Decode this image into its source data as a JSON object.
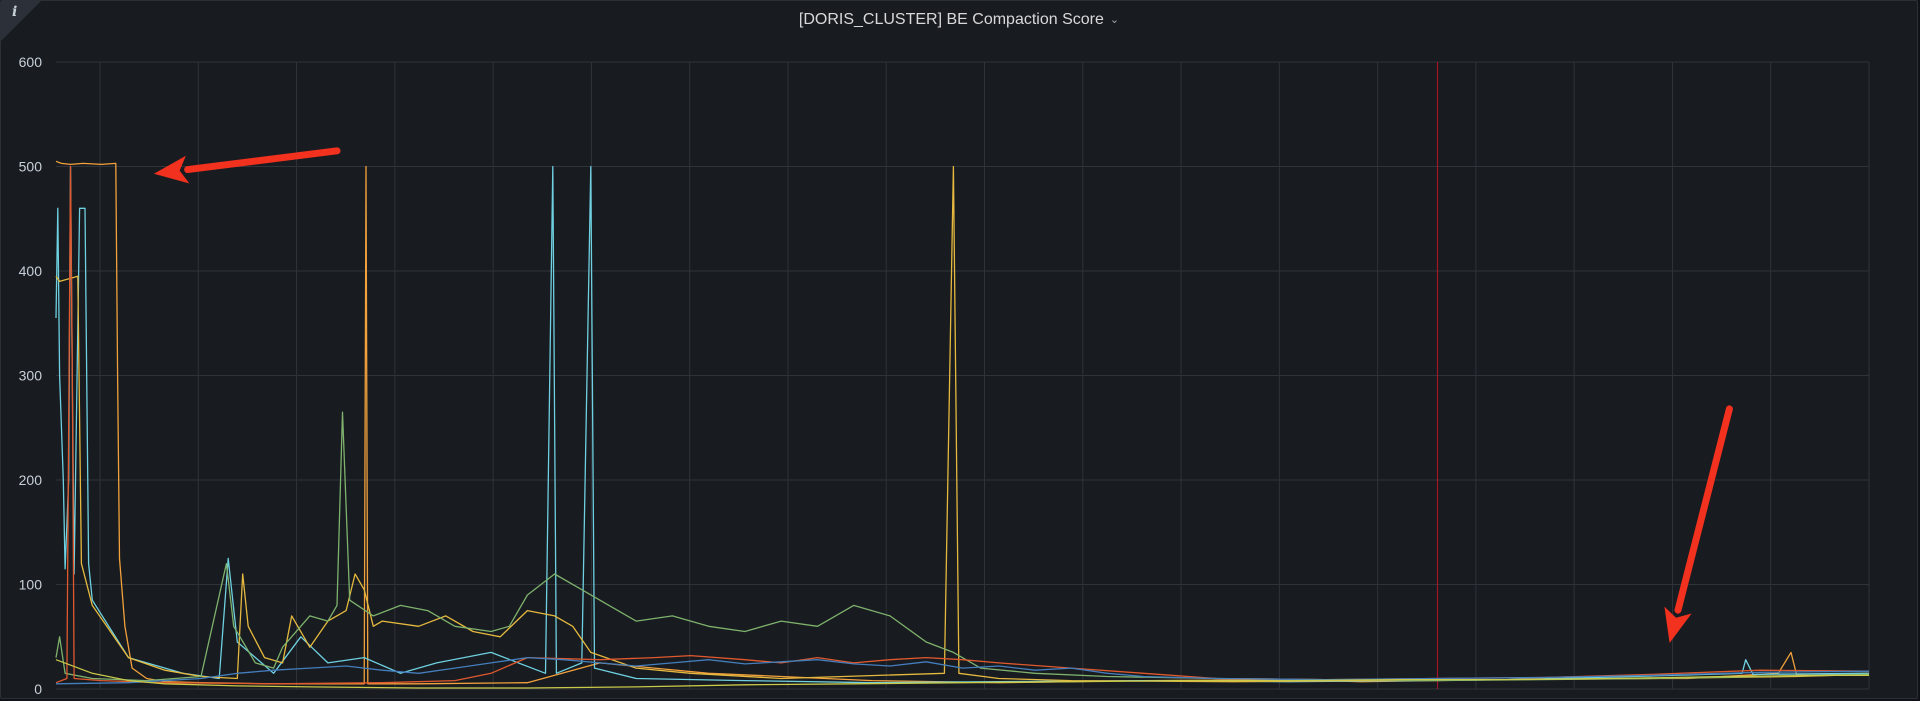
{
  "panel": {
    "title": "[DORIS_CLUSTER] BE Compaction Score",
    "info_icon": "info-icon",
    "menu_icon": "chevron-down-icon"
  },
  "chart_data": {
    "type": "line",
    "title": "[DORIS_CLUSTER] BE Compaction Score",
    "xlabel": "",
    "ylabel": "",
    "ylim": [
      0,
      600
    ],
    "yticks": [
      0,
      100,
      200,
      300,
      400,
      500,
      600
    ],
    "xlim": [
      0,
      1000
    ],
    "grid": true,
    "legend": "none",
    "annotation_x": 762,
    "annotation_color": "#c4162a",
    "arrow_color": "#f2311f",
    "series": [
      {
        "color": "#f2a13c",
        "points": [
          [
            0,
            505
          ],
          [
            3,
            503
          ],
          [
            8,
            502
          ],
          [
            15,
            503
          ],
          [
            25,
            502
          ],
          [
            33,
            503
          ],
          [
            34,
            300
          ],
          [
            35,
            125
          ],
          [
            38,
            60
          ],
          [
            42,
            20
          ],
          [
            50,
            10
          ],
          [
            60,
            7
          ],
          [
            80,
            6
          ],
          [
            120,
            5
          ],
          [
            170,
            5
          ],
          [
            171,
            500
          ],
          [
            172,
            5
          ],
          [
            200,
            5
          ],
          [
            260,
            6
          ],
          [
            300,
            25
          ],
          [
            330,
            20
          ],
          [
            360,
            15
          ],
          [
            400,
            12
          ],
          [
            450,
            8
          ],
          [
            520,
            6
          ],
          [
            600,
            8
          ],
          [
            680,
            9
          ],
          [
            720,
            7
          ],
          [
            760,
            8
          ],
          [
            800,
            9
          ],
          [
            850,
            10
          ],
          [
            900,
            10
          ],
          [
            950,
            15
          ],
          [
            957,
            35
          ],
          [
            960,
            14
          ],
          [
            1000,
            15
          ]
        ]
      },
      {
        "color": "#6ed0e0",
        "points": [
          [
            0,
            355
          ],
          [
            1,
            460
          ],
          [
            2,
            300
          ],
          [
            4,
            200
          ],
          [
            5,
            115
          ],
          [
            7,
            200
          ],
          [
            8,
            500
          ],
          [
            9,
            300
          ],
          [
            10,
            110
          ],
          [
            13,
            460
          ],
          [
            16,
            460
          ],
          [
            18,
            120
          ],
          [
            20,
            85
          ],
          [
            40,
            30
          ],
          [
            70,
            15
          ],
          [
            90,
            10
          ],
          [
            95,
            125
          ],
          [
            100,
            45
          ],
          [
            120,
            15
          ],
          [
            135,
            50
          ],
          [
            150,
            25
          ],
          [
            170,
            30
          ],
          [
            190,
            15
          ],
          [
            210,
            25
          ],
          [
            240,
            35
          ],
          [
            270,
            15
          ],
          [
            274,
            500
          ],
          [
            276,
            15
          ],
          [
            290,
            25
          ],
          [
            295,
            500
          ],
          [
            297,
            20
          ],
          [
            320,
            10
          ],
          [
            380,
            8
          ],
          [
            450,
            6
          ],
          [
            520,
            7
          ],
          [
            600,
            8
          ],
          [
            680,
            7
          ],
          [
            750,
            8
          ],
          [
            800,
            9
          ],
          [
            870,
            12
          ],
          [
            930,
            15
          ],
          [
            932,
            28
          ],
          [
            936,
            14
          ],
          [
            1000,
            15
          ]
        ]
      },
      {
        "color": "#e5b93f",
        "points": [
          [
            0,
            395
          ],
          [
            2,
            390
          ],
          [
            12,
            395
          ],
          [
            14,
            120
          ],
          [
            20,
            80
          ],
          [
            40,
            30
          ],
          [
            60,
            18
          ],
          [
            80,
            12
          ],
          [
            100,
            10
          ],
          [
            103,
            110
          ],
          [
            106,
            60
          ],
          [
            115,
            30
          ],
          [
            125,
            25
          ],
          [
            130,
            70
          ],
          [
            140,
            40
          ],
          [
            150,
            65
          ],
          [
            160,
            75
          ],
          [
            165,
            110
          ],
          [
            170,
            95
          ],
          [
            175,
            60
          ],
          [
            180,
            65
          ],
          [
            200,
            60
          ],
          [
            215,
            70
          ],
          [
            230,
            55
          ],
          [
            245,
            50
          ],
          [
            260,
            75
          ],
          [
            275,
            70
          ],
          [
            285,
            60
          ],
          [
            295,
            35
          ],
          [
            320,
            20
          ],
          [
            350,
            15
          ],
          [
            400,
            10
          ],
          [
            490,
            15
          ],
          [
            495,
            500
          ],
          [
            498,
            15
          ],
          [
            520,
            10
          ],
          [
            560,
            8
          ],
          [
            650,
            7
          ],
          [
            720,
            8
          ],
          [
            800,
            9
          ],
          [
            880,
            10
          ],
          [
            960,
            12
          ],
          [
            1000,
            14
          ]
        ]
      },
      {
        "color": "#7eb26d",
        "points": [
          [
            0,
            30
          ],
          [
            2,
            50
          ],
          [
            5,
            15
          ],
          [
            20,
            10
          ],
          [
            50,
            8
          ],
          [
            80,
            12
          ],
          [
            94,
            120
          ],
          [
            98,
            60
          ],
          [
            110,
            25
          ],
          [
            120,
            20
          ],
          [
            125,
            40
          ],
          [
            140,
            70
          ],
          [
            150,
            65
          ],
          [
            155,
            80
          ],
          [
            158,
            265
          ],
          [
            162,
            85
          ],
          [
            175,
            70
          ],
          [
            190,
            80
          ],
          [
            205,
            75
          ],
          [
            220,
            60
          ],
          [
            240,
            55
          ],
          [
            250,
            60
          ],
          [
            260,
            90
          ],
          [
            275,
            110
          ],
          [
            290,
            95
          ],
          [
            305,
            80
          ],
          [
            320,
            65
          ],
          [
            340,
            70
          ],
          [
            360,
            60
          ],
          [
            380,
            55
          ],
          [
            400,
            65
          ],
          [
            420,
            60
          ],
          [
            440,
            80
          ],
          [
            460,
            70
          ],
          [
            480,
            45
          ],
          [
            495,
            35
          ],
          [
            510,
            20
          ],
          [
            540,
            15
          ],
          [
            580,
            12
          ],
          [
            640,
            10
          ],
          [
            700,
            9
          ],
          [
            760,
            8
          ],
          [
            820,
            9
          ],
          [
            880,
            10
          ],
          [
            940,
            12
          ],
          [
            1000,
            14
          ]
        ]
      },
      {
        "color": "#e0592e",
        "points": [
          [
            0,
            6
          ],
          [
            6,
            10
          ],
          [
            8,
            500
          ],
          [
            9,
            300
          ],
          [
            10,
            10
          ],
          [
            25,
            8
          ],
          [
            60,
            6
          ],
          [
            120,
            5
          ],
          [
            180,
            6
          ],
          [
            220,
            8
          ],
          [
            240,
            15
          ],
          [
            260,
            30
          ],
          [
            300,
            28
          ],
          [
            330,
            30
          ],
          [
            350,
            32
          ],
          [
            380,
            28
          ],
          [
            400,
            25
          ],
          [
            420,
            30
          ],
          [
            440,
            25
          ],
          [
            460,
            28
          ],
          [
            480,
            30
          ],
          [
            500,
            28
          ],
          [
            520,
            25
          ],
          [
            560,
            20
          ],
          [
            600,
            15
          ],
          [
            640,
            10
          ],
          [
            700,
            9
          ],
          [
            760,
            10
          ],
          [
            820,
            11
          ],
          [
            880,
            14
          ],
          [
            940,
            18
          ],
          [
            1000,
            17
          ]
        ]
      },
      {
        "color": "#447ebc",
        "points": [
          [
            0,
            5
          ],
          [
            40,
            6
          ],
          [
            80,
            10
          ],
          [
            100,
            15
          ],
          [
            120,
            18
          ],
          [
            140,
            20
          ],
          [
            160,
            22
          ],
          [
            180,
            18
          ],
          [
            200,
            15
          ],
          [
            220,
            20
          ],
          [
            240,
            25
          ],
          [
            260,
            30
          ],
          [
            280,
            28
          ],
          [
            300,
            25
          ],
          [
            320,
            22
          ],
          [
            340,
            25
          ],
          [
            360,
            28
          ],
          [
            380,
            24
          ],
          [
            400,
            26
          ],
          [
            420,
            28
          ],
          [
            440,
            24
          ],
          [
            460,
            22
          ],
          [
            480,
            26
          ],
          [
            500,
            20
          ],
          [
            520,
            22
          ],
          [
            540,
            18
          ],
          [
            560,
            20
          ],
          [
            580,
            15
          ],
          [
            600,
            12
          ],
          [
            640,
            10
          ],
          [
            700,
            9
          ],
          [
            760,
            10
          ],
          [
            820,
            11
          ],
          [
            880,
            13
          ],
          [
            940,
            16
          ],
          [
            1000,
            17
          ]
        ]
      },
      {
        "color": "#c9c94a",
        "points": [
          [
            0,
            28
          ],
          [
            20,
            15
          ],
          [
            40,
            8
          ],
          [
            60,
            5
          ],
          [
            100,
            3
          ],
          [
            140,
            2
          ],
          [
            200,
            1
          ],
          [
            260,
            1
          ],
          [
            320,
            2
          ],
          [
            380,
            4
          ],
          [
            440,
            5
          ],
          [
            500,
            6
          ],
          [
            560,
            7
          ],
          [
            620,
            8
          ],
          [
            680,
            8
          ],
          [
            740,
            9
          ],
          [
            800,
            9
          ],
          [
            860,
            10
          ],
          [
            920,
            12
          ],
          [
            980,
            13
          ],
          [
            1000,
            13
          ]
        ]
      }
    ],
    "arrows": [
      {
        "from": [
          155,
          515
        ],
        "to": [
          54,
          493
        ]
      },
      {
        "from": [
          923,
          268
        ],
        "to": [
          890,
          44
        ]
      }
    ]
  }
}
